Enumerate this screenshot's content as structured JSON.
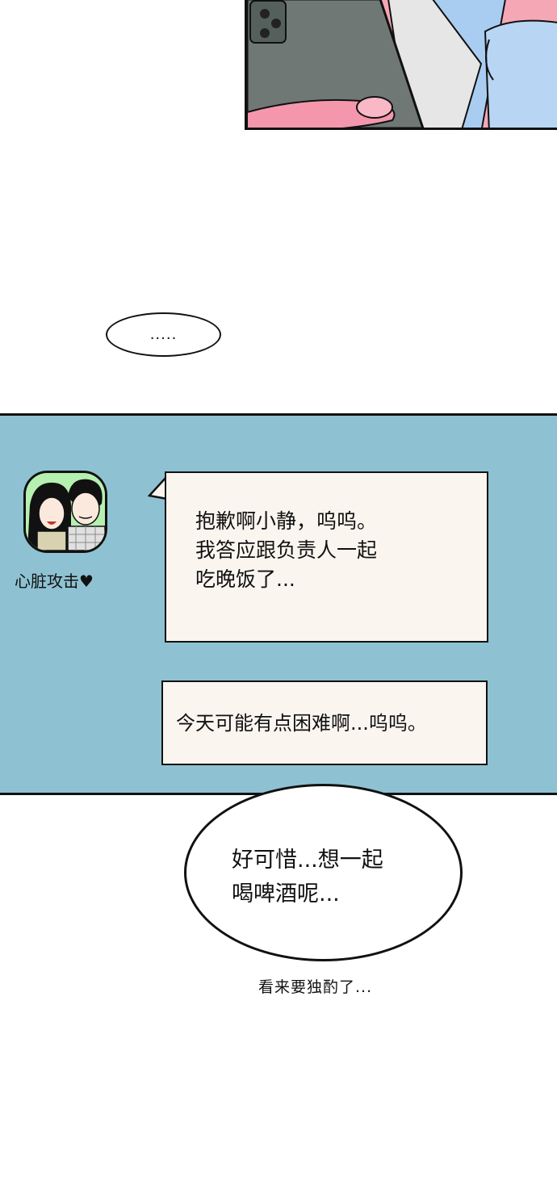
{
  "top_panel": {
    "description_icon": "phone-in-hand-illustration"
  },
  "small_bubble": {
    "text": "....."
  },
  "chat": {
    "contact": {
      "name": "心脏攻击♥",
      "avatar_icon": "couple-avatar-icon"
    },
    "messages": [
      {
        "lines": [
          "抱歉啊小静，呜呜。",
          "我答应跟负责人一起",
          "吃晚饭了..."
        ]
      },
      {
        "lines": [
          "今天可能有点困难啊...呜呜。"
        ]
      }
    ]
  },
  "big_bubble": {
    "lines": [
      "好可惜...想一起",
      "喝啤酒呢..."
    ]
  },
  "caption": {
    "text": "看来要独酌了..."
  },
  "colors": {
    "chat_background": "#8ec2d2",
    "message_background": "#fbf5f0",
    "top_panel_pink": "#f6a7b6"
  }
}
